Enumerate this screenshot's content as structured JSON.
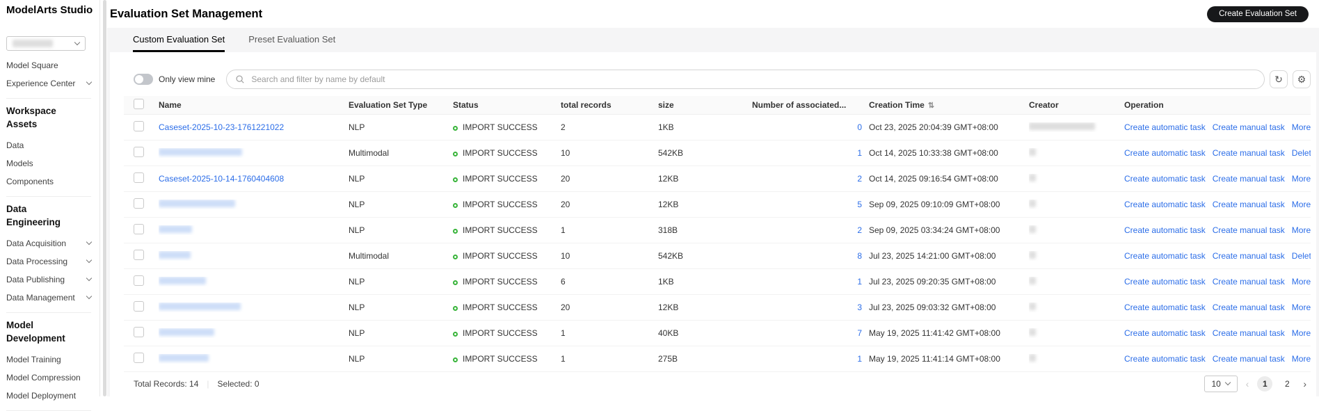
{
  "colors": {
    "accent_blue": "#2b6de8",
    "status_green": "#38b43a",
    "button_black": "#17181a",
    "tab_underline": "#000000"
  },
  "icons": {
    "gear": "⚙",
    "refresh": "↻",
    "sort": "⇅",
    "prev": "‹",
    "next": "›"
  },
  "sidebar": {
    "title": "ModelArts Studio",
    "items": [
      {
        "type": "dropdown",
        "label": "",
        "blurred": true
      },
      {
        "type": "link",
        "label": "Model Square"
      },
      {
        "type": "link",
        "label": "Experience Center",
        "chevron": true
      },
      {
        "type": "divider"
      },
      {
        "type": "section",
        "label": "Workspace Assets"
      },
      {
        "type": "link",
        "label": "Data"
      },
      {
        "type": "link",
        "label": "Models"
      },
      {
        "type": "link",
        "label": "Components"
      },
      {
        "type": "divider"
      },
      {
        "type": "section",
        "label": "Data Engineering"
      },
      {
        "type": "link",
        "label": "Data Acquisition",
        "chevron": true
      },
      {
        "type": "link",
        "label": "Data Processing",
        "chevron": true
      },
      {
        "type": "link",
        "label": "Data Publishing",
        "chevron": true
      },
      {
        "type": "link",
        "label": "Data Management",
        "chevron": true
      },
      {
        "type": "divider"
      },
      {
        "type": "section",
        "label": "Model Development"
      },
      {
        "type": "link",
        "label": "Model Training"
      },
      {
        "type": "link",
        "label": "Model Compression"
      },
      {
        "type": "link",
        "label": "Model Deployment"
      },
      {
        "type": "divider"
      }
    ]
  },
  "header": {
    "title": "Evaluation Set Management",
    "create_button_label": "Create Evaluation Set"
  },
  "tabs": [
    {
      "label": "Custom Evaluation Set",
      "active": true
    },
    {
      "label": "Preset Evaluation Set",
      "active": false
    }
  ],
  "filters": {
    "toggle_label": "Only view mine",
    "toggle_state": "off",
    "search_placeholder": "Search and filter by name by default"
  },
  "table": {
    "columns": [
      {
        "label": "Name"
      },
      {
        "label": "Evaluation Set Type"
      },
      {
        "label": "Status"
      },
      {
        "label": "total records"
      },
      {
        "label": "size"
      },
      {
        "label": "Number of associated..."
      },
      {
        "label": "Creation Time",
        "sortable": true
      },
      {
        "label": "Creator"
      },
      {
        "label": "Operation"
      }
    ],
    "op_labels": {
      "automatic": "Create automatic task",
      "manual": "Create manual task"
    },
    "rows": [
      {
        "name": "Caseset-2025-10-23-1761221022",
        "name_blurred": false,
        "type": "NLP",
        "status": "IMPORT SUCCESS",
        "records": "2",
        "size": "1KB",
        "associated": "0",
        "creation_time": "Oct 23, 2025 20:04:39 GMT+08:00",
        "creator_blur_width": 95,
        "more_label": "More",
        "more_chevron": true
      },
      {
        "name": "",
        "name_blurred": true,
        "name_blur_width": 120,
        "type": "Multimodal",
        "status": "IMPORT SUCCESS",
        "records": "10",
        "size": "542KB",
        "associated": "1",
        "creation_time": "Oct 14, 2025 10:33:38 GMT+08:00",
        "creator_blur_width": 10,
        "more_label": "Delete",
        "more_chevron": false
      },
      {
        "name": "Caseset-2025-10-14-1760404608",
        "name_blurred": false,
        "type": "NLP",
        "status": "IMPORT SUCCESS",
        "records": "20",
        "size": "12KB",
        "associated": "2",
        "creation_time": "Oct 14, 2025 09:16:54 GMT+08:00",
        "creator_blur_width": 10,
        "more_label": "More",
        "more_chevron": true
      },
      {
        "name": "",
        "name_blurred": true,
        "name_blur_width": 110,
        "type": "NLP",
        "status": "IMPORT SUCCESS",
        "records": "20",
        "size": "12KB",
        "associated": "5",
        "creation_time": "Sep 09, 2025 09:10:09 GMT+08:00",
        "creator_blur_width": 10,
        "more_label": "More",
        "more_chevron": true
      },
      {
        "name": "",
        "name_blurred": true,
        "name_blur_width": 48,
        "type": "NLP",
        "status": "IMPORT SUCCESS",
        "records": "1",
        "size": "318B",
        "associated": "2",
        "creation_time": "Sep 09, 2025 03:34:24 GMT+08:00",
        "creator_blur_width": 10,
        "more_label": "More",
        "more_chevron": true
      },
      {
        "name": "",
        "name_blurred": true,
        "name_blur_width": 46,
        "type": "Multimodal",
        "status": "IMPORT SUCCESS",
        "records": "10",
        "size": "542KB",
        "associated": "8",
        "creation_time": "Jul 23, 2025 14:21:00 GMT+08:00",
        "creator_blur_width": 10,
        "more_label": "Delete",
        "more_chevron": false
      },
      {
        "name": "",
        "name_blurred": true,
        "name_blur_width": 68,
        "type": "NLP",
        "status": "IMPORT SUCCESS",
        "records": "6",
        "size": "1KB",
        "associated": "1",
        "creation_time": "Jul 23, 2025 09:20:35 GMT+08:00",
        "creator_blur_width": 10,
        "more_label": "More",
        "more_chevron": true
      },
      {
        "name": "",
        "name_blurred": true,
        "name_blur_width": 118,
        "type": "NLP",
        "status": "IMPORT SUCCESS",
        "records": "20",
        "size": "12KB",
        "associated": "3",
        "creation_time": "Jul 23, 2025 09:03:32 GMT+08:00",
        "creator_blur_width": 10,
        "more_label": "More",
        "more_chevron": true
      },
      {
        "name": "",
        "name_blurred": true,
        "name_blur_width": 80,
        "type": "NLP",
        "status": "IMPORT SUCCESS",
        "records": "1",
        "size": "40KB",
        "associated": "7",
        "creation_time": "May 19, 2025 11:41:42 GMT+08:00",
        "creator_blur_width": 10,
        "more_label": "More",
        "more_chevron": true
      },
      {
        "name": "",
        "name_blurred": true,
        "name_blur_width": 72,
        "type": "NLP",
        "status": "IMPORT SUCCESS",
        "records": "1",
        "size": "275B",
        "associated": "1",
        "creation_time": "May 19, 2025 11:41:14 GMT+08:00",
        "creator_blur_width": 10,
        "more_label": "More",
        "more_chevron": true
      }
    ]
  },
  "footer": {
    "total_records": "Total Records: 14",
    "selected": "Selected: 0",
    "page_size": "10",
    "pages": [
      "1",
      "2"
    ],
    "current_page": "1"
  }
}
